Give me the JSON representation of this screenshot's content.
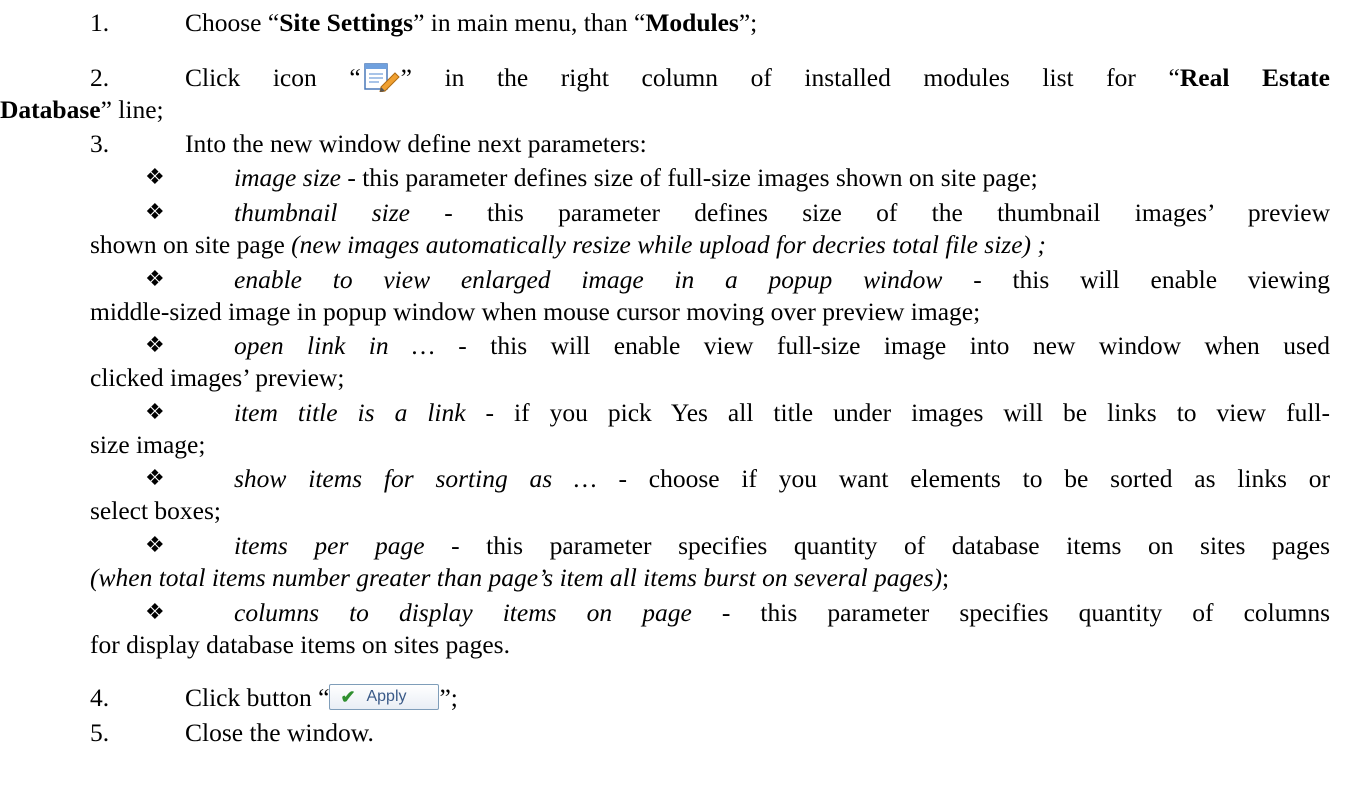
{
  "steps": [
    {
      "number": "1.",
      "pre": "Choose “",
      "b1": "Site Settings",
      "mid": "” in main menu, than “",
      "b2": "Modules",
      "post": "”;"
    },
    {
      "number": "2.",
      "pre": "Click icon “",
      "icon": "edit-icon",
      "mid": "” in the right column of installed modules list for “",
      "b1": "Real Estate",
      "b2": "Database",
      "post": "” line;"
    },
    {
      "number": "3.",
      "text": "Into the new window define next parameters:"
    },
    {
      "number": "4.",
      "pre": "Click button “",
      "button_label": "Apply",
      "button_icon": "checkmark-icon",
      "post": "”;"
    },
    {
      "number": "5.",
      "text": "Close the window."
    }
  ],
  "parameters": [
    {
      "name": "image size",
      "desc": " - this parameter defines size of full-size images shown on site page;"
    },
    {
      "name": "thumbnail size",
      "desc1": " - this parameter defines size of the thumbnail images’ preview",
      "desc2": "shown on site page ",
      "note": "(new images automatically resize while upload for decries total file size) ;"
    },
    {
      "name": "enable to view enlarged image in a popup window",
      "desc1": " - this will enable viewing",
      "desc2": "middle-sized image in popup window when mouse cursor moving over preview image;"
    },
    {
      "name": "open link in …",
      "desc1": " - this will enable view full-size image into new window when used",
      "desc2": "clicked images’ preview;"
    },
    {
      "name": "item title is a link",
      "desc1": " - if you pick Yes all title under images will be links to view full-",
      "desc2": "size image;"
    },
    {
      "name": "show items for sorting as …",
      "desc1": " - choose if you want elements to be sorted as links or",
      "desc2": "select boxes;"
    },
    {
      "name": "items per page",
      "desc1": " - this parameter specifies quantity of database items on sites pages",
      "note": "(when total items number greater than page’s item all items burst on several pages)",
      "desc2": ";"
    },
    {
      "name": "columns to display items on page",
      "desc1": " - this parameter specifies quantity of columns",
      "desc2": "for display database items on sites pages."
    }
  ],
  "bullet_glyph": "❖",
  "colors": {
    "text": "#000000",
    "apply_border": "#7f9db9",
    "apply_text": "#3a5a88",
    "check": "#2f8f2f"
  }
}
